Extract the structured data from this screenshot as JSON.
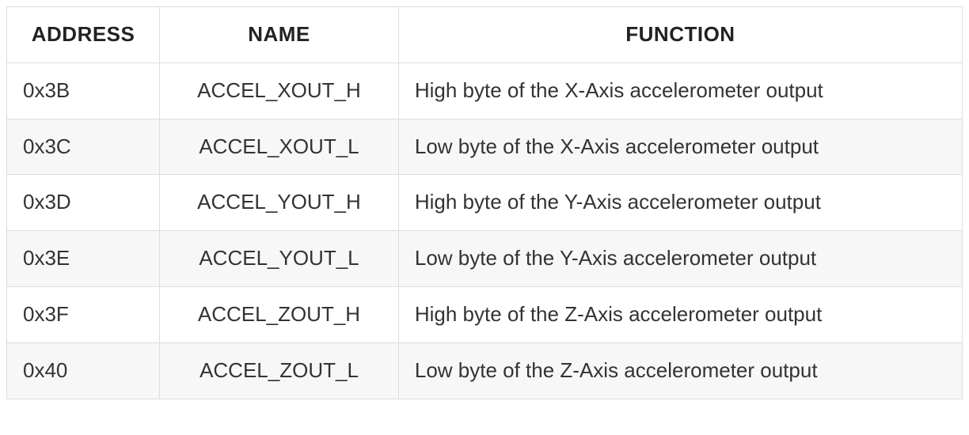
{
  "table": {
    "headers": {
      "address": "ADDRESS",
      "name": "NAME",
      "function": "FUNCTION"
    },
    "rows": [
      {
        "address": "0x3B",
        "name": "ACCEL_XOUT_H",
        "function": "High byte of the X-Axis accelerometer output"
      },
      {
        "address": "0x3C",
        "name": "ACCEL_XOUT_L",
        "function": "Low byte of the X-Axis accelerometer output"
      },
      {
        "address": "0x3D",
        "name": "ACCEL_YOUT_H",
        "function": "High byte of the Y-Axis accelerometer output"
      },
      {
        "address": "0x3E",
        "name": "ACCEL_YOUT_L",
        "function": "Low byte of the Y-Axis accelerometer output"
      },
      {
        "address": "0x3F",
        "name": "ACCEL_ZOUT_H",
        "function": "High byte of the Z-Axis accelerometer output"
      },
      {
        "address": "0x40",
        "name": "ACCEL_ZOUT_L",
        "function": "Low byte of the Z-Axis accelerometer output"
      }
    ]
  }
}
